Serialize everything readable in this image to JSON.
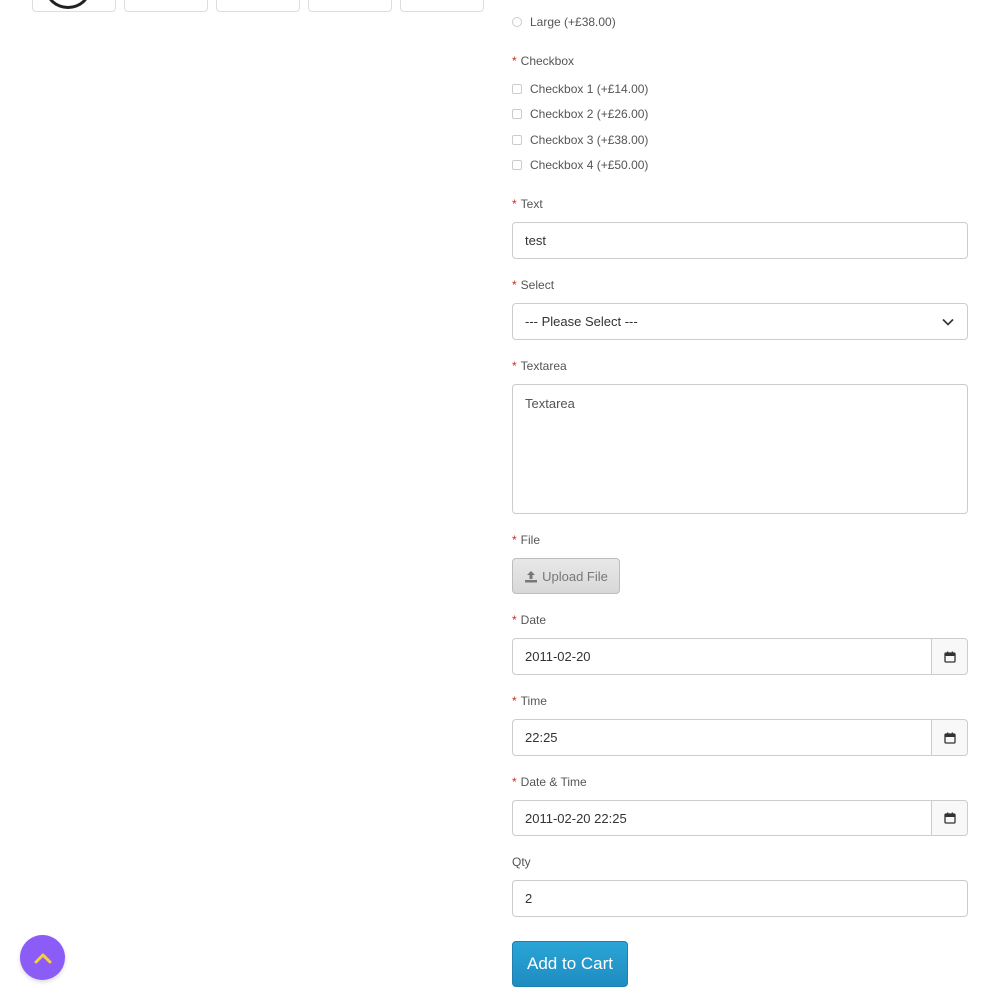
{
  "options": {
    "radio_last_label": "Large (+£38.00)",
    "checkbox_label": "Checkbox",
    "checkboxes": [
      "Checkbox 1 (+£14.00)",
      "Checkbox 2 (+£26.00)",
      "Checkbox 3 (+£38.00)",
      "Checkbox 4 (+£50.00)"
    ]
  },
  "fields": {
    "text_label": "Text",
    "text_value": "test",
    "select_label": "Select",
    "select_value": "--- Please Select ---",
    "textarea_label": "Textarea",
    "textarea_value": "Textarea",
    "file_label": "File",
    "upload_button": "Upload File",
    "date_label": "Date",
    "date_value": "2011-02-20",
    "time_label": "Time",
    "time_value": "22:25",
    "datetime_label": "Date & Time",
    "datetime_value": "2011-02-20 22:25",
    "qty_label": "Qty",
    "qty_value": "2"
  },
  "actions": {
    "add_to_cart": "Add to Cart"
  },
  "required_marker": "*",
  "colors": {
    "accent_button": "#1f8cc0",
    "scroll_top_button": "#8b5cf6",
    "required": "#d9261c"
  },
  "icons": {
    "upload": "upload-icon",
    "calendar": "calendar-icon",
    "chevron": "chevron-down-icon",
    "scroll_top": "chevron-up-icon"
  }
}
